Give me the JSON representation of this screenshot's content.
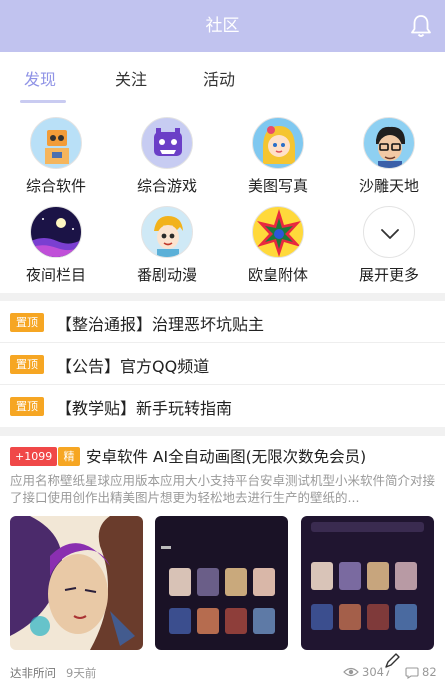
{
  "header": {
    "title": "社区",
    "icon": "bell-icon"
  },
  "tabs": [
    {
      "label": "发现",
      "active": true
    },
    {
      "label": "关注",
      "active": false
    },
    {
      "label": "活动",
      "active": false
    }
  ],
  "categories": [
    {
      "label": "综合软件",
      "icon": "robot-avatar-icon"
    },
    {
      "label": "综合游戏",
      "icon": "game-monster-icon"
    },
    {
      "label": "美图写真",
      "icon": "girl-avatar-icon"
    },
    {
      "label": "沙雕天地",
      "icon": "glasses-man-icon"
    },
    {
      "label": "夜间栏目",
      "icon": "moon-night-icon"
    },
    {
      "label": "番剧动漫",
      "icon": "anime-character-icon"
    },
    {
      "label": "欧皇附体",
      "icon": "star-burst-icon"
    },
    {
      "label": "展开更多",
      "icon": "chevron-down-icon"
    }
  ],
  "pinned": [
    {
      "badge": "置顶",
      "text": "【整治通报】治理恶坏坑贴主"
    },
    {
      "badge": "置顶",
      "text": "【公告】官方QQ频道"
    },
    {
      "badge": "置顶",
      "text": "【教学贴】新手玩转指南"
    }
  ],
  "post": {
    "badge_plus": "+1099",
    "badge_fine": "精",
    "title": "安卓软件 AI全自动画图(无限次数免会员)",
    "description": "应用名称壁纸星球应用版本应用大小支持平台安卓测试机型小米软件简介对接了接口使用创作出精美图片想更为轻松地去进行生产的壁纸的...",
    "author": "达非所问",
    "time": "9天前",
    "views": "3047",
    "comments": "82"
  },
  "colors": {
    "header": "#c1c3ef",
    "accent": "#8f93e6",
    "pin_badge": "#f6a623",
    "plus_badge": "#f04848"
  }
}
